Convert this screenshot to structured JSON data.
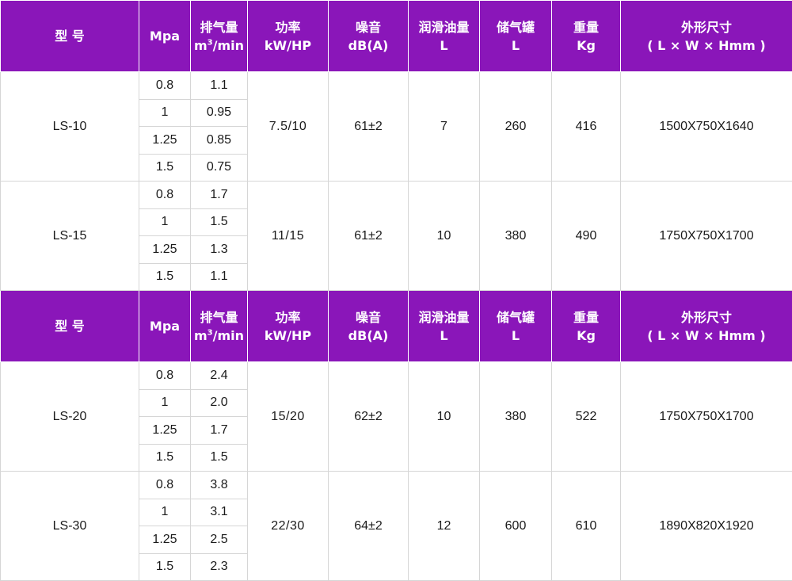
{
  "header": {
    "model": "型 号",
    "mpa": "Mpa",
    "flow": {
      "l1": "排气量",
      "l2a": "m",
      "l2sup": "3",
      "l2b": "/min"
    },
    "power": {
      "l1": "功率",
      "l2": "kW/HP"
    },
    "noise": {
      "l1": "噪音",
      "l2": "dB(A)"
    },
    "oil": {
      "l1": "润滑油量",
      "l2": "L"
    },
    "tank": {
      "l1": "储气罐",
      "l2": "L"
    },
    "weight": {
      "l1": "重量",
      "l2": "Kg"
    },
    "dims": {
      "l1": "外形尺寸",
      "l2": "( L × W × Hmm )"
    }
  },
  "models": [
    {
      "name": "LS-10",
      "power": "7.5/10",
      "noise": "61±2",
      "oil": "7",
      "tank": "260",
      "weight": "416",
      "dims": "1500X750X1640",
      "rows": [
        {
          "mpa": "0.8",
          "flow": "1.1"
        },
        {
          "mpa": "1",
          "flow": "0.95"
        },
        {
          "mpa": "1.25",
          "flow": "0.85"
        },
        {
          "mpa": "1.5",
          "flow": "0.75"
        }
      ]
    },
    {
      "name": "LS-15",
      "power": "11/15",
      "noise": "61±2",
      "oil": "10",
      "tank": "380",
      "weight": "490",
      "dims": "1750X750X1700",
      "rows": [
        {
          "mpa": "0.8",
          "flow": "1.7"
        },
        {
          "mpa": "1",
          "flow": "1.5"
        },
        {
          "mpa": "1.25",
          "flow": "1.3"
        },
        {
          "mpa": "1.5",
          "flow": "1.1"
        }
      ]
    },
    {
      "name": "LS-20",
      "power": "15/20",
      "noise": "62±2",
      "oil": "10",
      "tank": "380",
      "weight": "522",
      "dims": "1750X750X1700",
      "rows": [
        {
          "mpa": "0.8",
          "flow": "2.4"
        },
        {
          "mpa": "1",
          "flow": "2.0"
        },
        {
          "mpa": "1.25",
          "flow": "1.7"
        },
        {
          "mpa": "1.5",
          "flow": "1.5"
        }
      ]
    },
    {
      "name": "LS-30",
      "power": "22/30",
      "noise": "64±2",
      "oil": "12",
      "tank": "600",
      "weight": "610",
      "dims": "1890X820X1920",
      "rows": [
        {
          "mpa": "0.8",
          "flow": "3.8"
        },
        {
          "mpa": "1",
          "flow": "3.1"
        },
        {
          "mpa": "1.25",
          "flow": "2.5"
        },
        {
          "mpa": "1.5",
          "flow": "2.3"
        }
      ]
    }
  ],
  "colors": {
    "header_bg": "#8a16b9",
    "model_text": "#8a16b9",
    "border": "#d6d6d6"
  }
}
